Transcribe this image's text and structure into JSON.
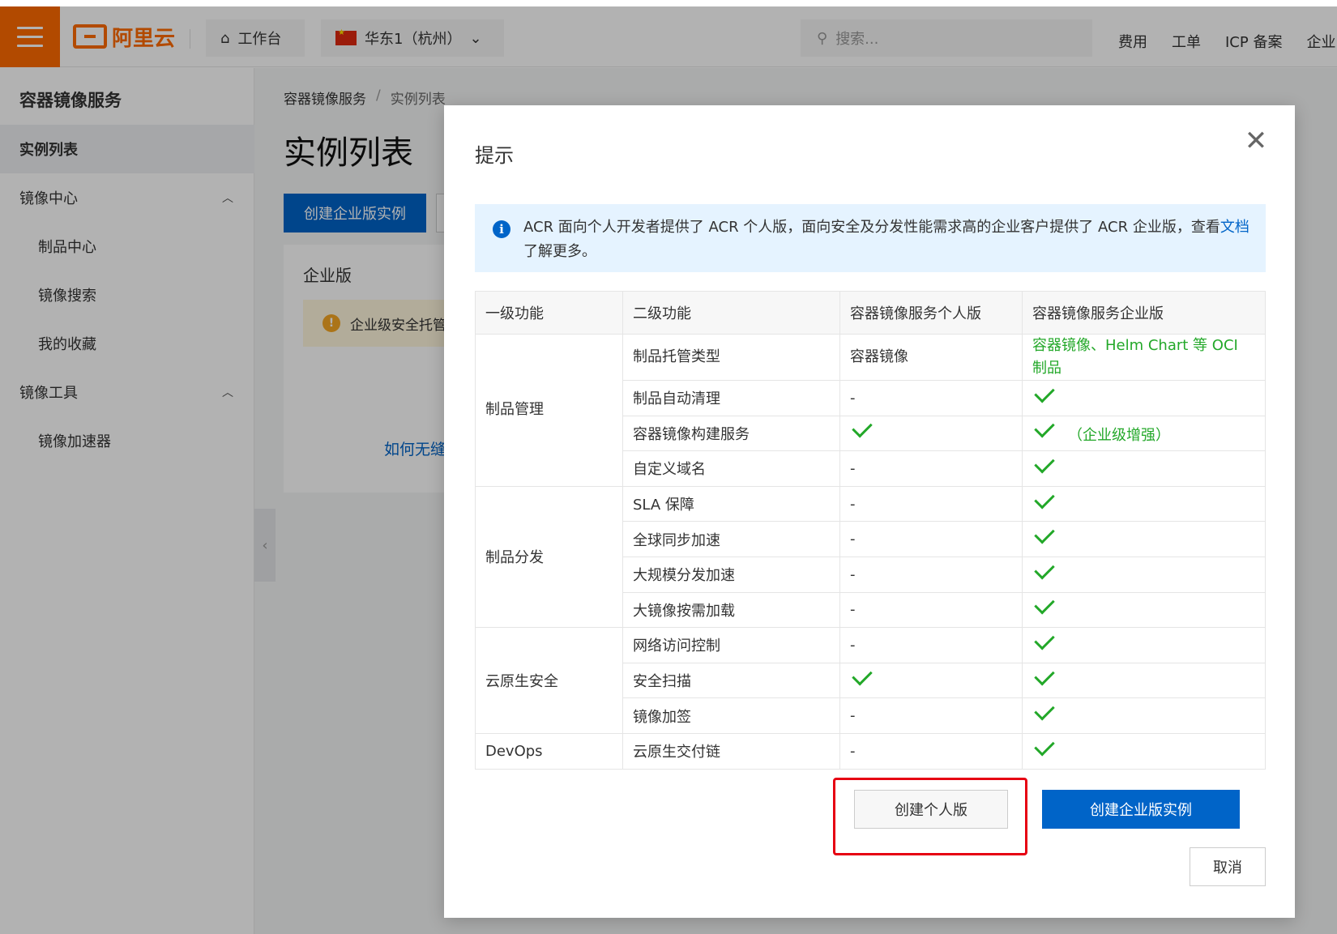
{
  "topbar": {
    "logo": "阿里云",
    "workbench": "工作台",
    "region": "华东1（杭州）",
    "search_placeholder": "搜索...",
    "links": [
      "费用",
      "工单",
      "ICP 备案",
      "企业"
    ]
  },
  "sidebar": {
    "title": "容器镜像服务",
    "items": [
      {
        "label": "实例列表"
      },
      {
        "label": "镜像中心"
      },
      {
        "label": "制品中心"
      },
      {
        "label": "镜像搜索"
      },
      {
        "label": "我的收藏"
      },
      {
        "label": "镜像工具"
      },
      {
        "label": "镜像加速器"
      }
    ]
  },
  "main": {
    "breadcrumb": [
      "容器镜像服务",
      "/",
      "实例列表"
    ],
    "title": "实例列表",
    "create_button": "创建企业版实例",
    "card_title": "企业版",
    "card_alert": "企业级安全托管",
    "card_link": "如何无缝"
  },
  "dialog": {
    "title": "提示",
    "close": "✕",
    "info_text": "ACR 面向个人开发者提供了 ACR 个人版，面向安全及分发性能需求高的企业客户提供了 ACR 企业版，查看",
    "info_link": "文档",
    "info_tail": "了解更多。",
    "table": {
      "headers": [
        "一级功能",
        "二级功能",
        "容器镜像服务个人版",
        "容器镜像服务企业版"
      ],
      "groups": [
        {
          "name": "制品管理",
          "rows": [
            {
              "feature": "制品托管类型",
              "personal": "容器镜像",
              "enterprise": "容器镜像、Helm Chart 等 OCI 制品"
            },
            {
              "feature": "制品自动清理",
              "personal": "-",
              "enterprise": ""
            },
            {
              "feature": "容器镜像构建服务",
              "personal": "",
              "enterprise": "（企业级增强）"
            },
            {
              "feature": "自定义域名",
              "personal": "-",
              "enterprise": ""
            }
          ]
        },
        {
          "name": "制品分发",
          "rows": [
            {
              "feature": "SLA 保障",
              "personal": "-",
              "enterprise": ""
            },
            {
              "feature": "全球同步加速",
              "personal": "-",
              "enterprise": ""
            },
            {
              "feature": "大规模分发加速",
              "personal": "-",
              "enterprise": ""
            },
            {
              "feature": "大镜像按需加载",
              "personal": "-",
              "enterprise": ""
            }
          ]
        },
        {
          "name": "云原生安全",
          "rows": [
            {
              "feature": "网络访问控制",
              "personal": "-",
              "enterprise": ""
            },
            {
              "feature": "安全扫描",
              "personal": "",
              "enterprise": ""
            },
            {
              "feature": "镜像加签",
              "personal": "-",
              "enterprise": ""
            }
          ]
        },
        {
          "name": "DevOps",
          "rows": [
            {
              "feature": "云原生交付链",
              "personal": "-",
              "enterprise": ""
            }
          ]
        }
      ]
    },
    "btn_personal": "创建个人版",
    "btn_enterprise": "创建企业版实例",
    "btn_cancel": "取消"
  },
  "colors": {
    "brand_orange": "#ff6a00",
    "primary_blue": "#0064c8",
    "check_green": "#23a829",
    "highlight_red": "#e60012"
  }
}
